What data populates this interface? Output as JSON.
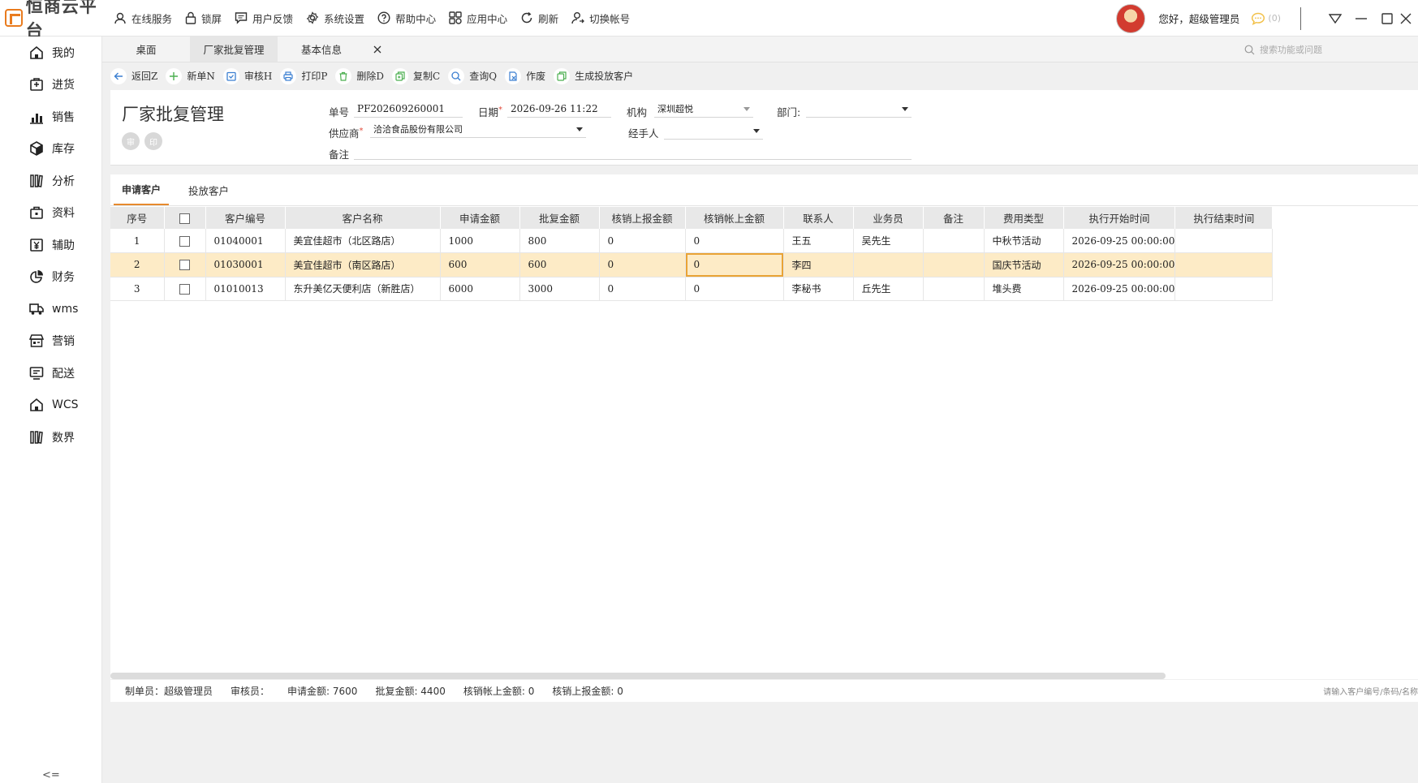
{
  "app": {
    "logo_text": "恒商云平台"
  },
  "topnav": [
    {
      "label": "在线服务",
      "icon": "headset-icon"
    },
    {
      "label": "锁屏",
      "icon": "lock-icon"
    },
    {
      "label": "用户反馈",
      "icon": "feedback-icon"
    },
    {
      "label": "系统设置",
      "icon": "gear-icon"
    },
    {
      "label": "帮助中心",
      "icon": "help-icon"
    },
    {
      "label": "应用中心",
      "icon": "apps-icon"
    },
    {
      "label": "刷新",
      "icon": "refresh-icon"
    },
    {
      "label": "切换帐号",
      "icon": "switch-user-icon"
    }
  ],
  "user": {
    "greeting": "您好，超级管理员",
    "messages": "(0)"
  },
  "sidebar": {
    "items": [
      {
        "label": "我的",
        "icon": "home-icon"
      },
      {
        "label": "进货",
        "icon": "purchase-icon"
      },
      {
        "label": "销售",
        "icon": "sales-chart-icon"
      },
      {
        "label": "库存",
        "icon": "box-icon"
      },
      {
        "label": "分析",
        "icon": "analysis-icon"
      },
      {
        "label": "资料",
        "icon": "briefcase-icon"
      },
      {
        "label": "辅助",
        "icon": "yen-doc-icon"
      },
      {
        "label": "财务",
        "icon": "pie-icon"
      },
      {
        "label": "wms",
        "icon": "truck-icon"
      },
      {
        "label": "营销",
        "icon": "store-icon"
      },
      {
        "label": "配送",
        "icon": "monitor-icon"
      },
      {
        "label": "WCS",
        "icon": "home-icon"
      },
      {
        "label": "数界",
        "icon": "analysis-icon"
      }
    ],
    "collapse_label": "<="
  },
  "tabs": [
    {
      "label": "桌面",
      "active": false
    },
    {
      "label": "厂家批复管理",
      "active": true
    },
    {
      "label": "基本信息",
      "active": false
    }
  ],
  "search": {
    "placeholder": "搜索功能或问题"
  },
  "toolbar": [
    {
      "label": "返回Z",
      "icon": "back-arrow-icon"
    },
    {
      "label": "新单N",
      "icon": "plus-icon"
    },
    {
      "label": "审核H",
      "icon": "approve-icon"
    },
    {
      "label": "打印P",
      "icon": "print-icon"
    },
    {
      "label": "删除D",
      "icon": "trash-icon"
    },
    {
      "label": "复制C",
      "icon": "copy-icon"
    },
    {
      "label": "查询Q",
      "icon": "search-icon"
    },
    {
      "label": "作废",
      "icon": "void-icon"
    },
    {
      "label": "生成投放客户",
      "icon": "generate-icon"
    }
  ],
  "form": {
    "title": "厂家批复管理",
    "order_no_label": "单号",
    "order_no": "PF202609260001",
    "date_label": "日期",
    "date": "2026-09-26 11:22",
    "org_label": "机构",
    "org": "深圳超悦",
    "dept_label": "部门:",
    "dept": "",
    "supplier_label": "供应商",
    "supplier": "洽洽食品股份有限公司",
    "handler_label": "经手人",
    "handler": "",
    "remark_label": "备注",
    "remark": "",
    "stamp_approve": "审",
    "stamp_print": "印"
  },
  "subtabs": [
    {
      "label": "申请客户",
      "active": true
    },
    {
      "label": "投放客户",
      "active": false
    }
  ],
  "grid": {
    "columns": [
      "序号",
      "",
      "客户编号",
      "客户名称",
      "申请金额",
      "批复金额",
      "核销上报金额",
      "核销帐上金额",
      "联系人",
      "业务员",
      "备注",
      "费用类型",
      "执行开始时间",
      "执行结束时间"
    ],
    "rows": [
      [
        "1",
        "",
        "01040001",
        "美宜佳超市（北区路店）",
        "1000",
        "800",
        "0",
        "0",
        "王五",
        "吴先生",
        "",
        "中秋节活动",
        "2026-09-25 00:00:00",
        ""
      ],
      [
        "2",
        "",
        "01030001",
        "美宜佳超市（南区路店）",
        "600",
        "600",
        "0",
        "0",
        "李四",
        "",
        "",
        "国庆节活动",
        "2026-09-25 00:00:00",
        ""
      ],
      [
        "3",
        "",
        "01010013",
        "东升美亿天便利店（新胜店）",
        "6000",
        "3000",
        "0",
        "0",
        "李秘书",
        "丘先生",
        "",
        "堆头费",
        "2026-09-25 00:00:00",
        ""
      ]
    ],
    "selected_row": 1
  },
  "footer": {
    "maker": "制单员：超级管理员",
    "auditor": "审核员：",
    "apply_total": "申请金额: 7600",
    "approve_total": "批复金额:   4400",
    "account_total": "核销帐上金额: 0",
    "report_total": "核销上报金额: 0",
    "hint": "请输入客户编号/条码/名称"
  },
  "colors": {
    "accent": "#e68a2e",
    "selected_row": "#fdebc6",
    "required": "#e24b3b"
  }
}
